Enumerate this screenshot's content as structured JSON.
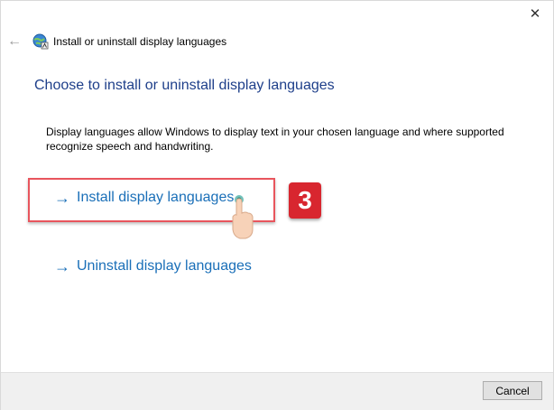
{
  "window": {
    "close_glyph": "✕"
  },
  "header": {
    "back_glyph": "←",
    "title": "Install or uninstall display languages",
    "icon": "globe-language-icon"
  },
  "main": {
    "heading": "Choose to install or uninstall display languages",
    "description": "Display languages allow Windows to display text in your chosen language and where supported recognize speech and handwriting.",
    "links": [
      {
        "arrow": "→",
        "label": "Install display languages"
      },
      {
        "arrow": "→",
        "label": "Uninstall display languages"
      }
    ]
  },
  "annotation": {
    "step_number": "3"
  },
  "footer": {
    "cancel_label": "Cancel"
  },
  "colors": {
    "link": "#1a6fb8",
    "heading": "#1e3f8a",
    "highlight": "#e8555d",
    "badge": "#d8262f"
  }
}
